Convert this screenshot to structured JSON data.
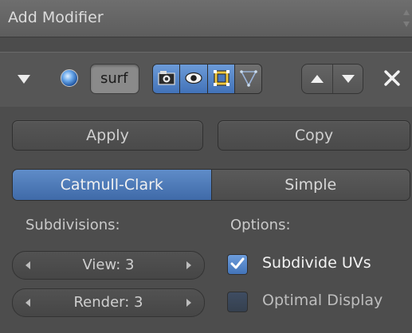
{
  "add_modifier": {
    "label": "Add Modifier"
  },
  "modifier": {
    "name": "surf",
    "header_icons": [
      "expand-chevron-icon",
      "subsurf-modifier-icon",
      "render-camera-icon",
      "viewport-eye-icon",
      "edit-mode-icon",
      "cage-vertex-icon",
      "move-up-icon",
      "move-down-icon",
      "close-icon"
    ],
    "apply_label": "Apply",
    "copy_label": "Copy",
    "algorithm_options": [
      "Catmull-Clark",
      "Simple"
    ],
    "algorithm_selected": "Catmull-Clark",
    "subdivisions": {
      "label": "Subdivisions:",
      "view": "View: 3",
      "render": "Render: 3"
    },
    "options": {
      "label": "Options:",
      "subdivide_uvs": {
        "label": "Subdivide UVs",
        "checked": true
      },
      "optimal_display": {
        "label": "Optimal Display",
        "checked": false
      }
    }
  },
  "colors": {
    "accent": "#5f8cc8",
    "panel": "#4d4d4d",
    "header": "#565656"
  }
}
